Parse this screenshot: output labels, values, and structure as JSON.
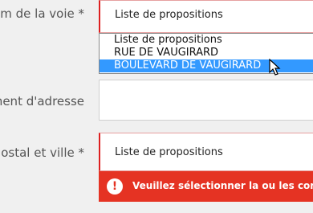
{
  "form": {
    "street_label": "m de la voie *",
    "street_value": "Liste de propositions",
    "complement_label": "ment d'adresse",
    "complement_value": "",
    "postal_label": "ostal et ville *",
    "postal_value": "Liste de propositions",
    "error_message": "Veuillez sélectionner la ou les corre"
  },
  "dropdown": {
    "options": [
      "Liste de propositions",
      "RUE DE VAUGIRARD",
      "BOULEVARD DE VAUGIRARD"
    ],
    "selected_index": 2
  },
  "colors": {
    "error_red": "#e53323",
    "selection_blue": "#3399ff"
  },
  "icons": {
    "error": "exclamation-circle-icon",
    "cursor": "mouse-cursor-icon"
  }
}
